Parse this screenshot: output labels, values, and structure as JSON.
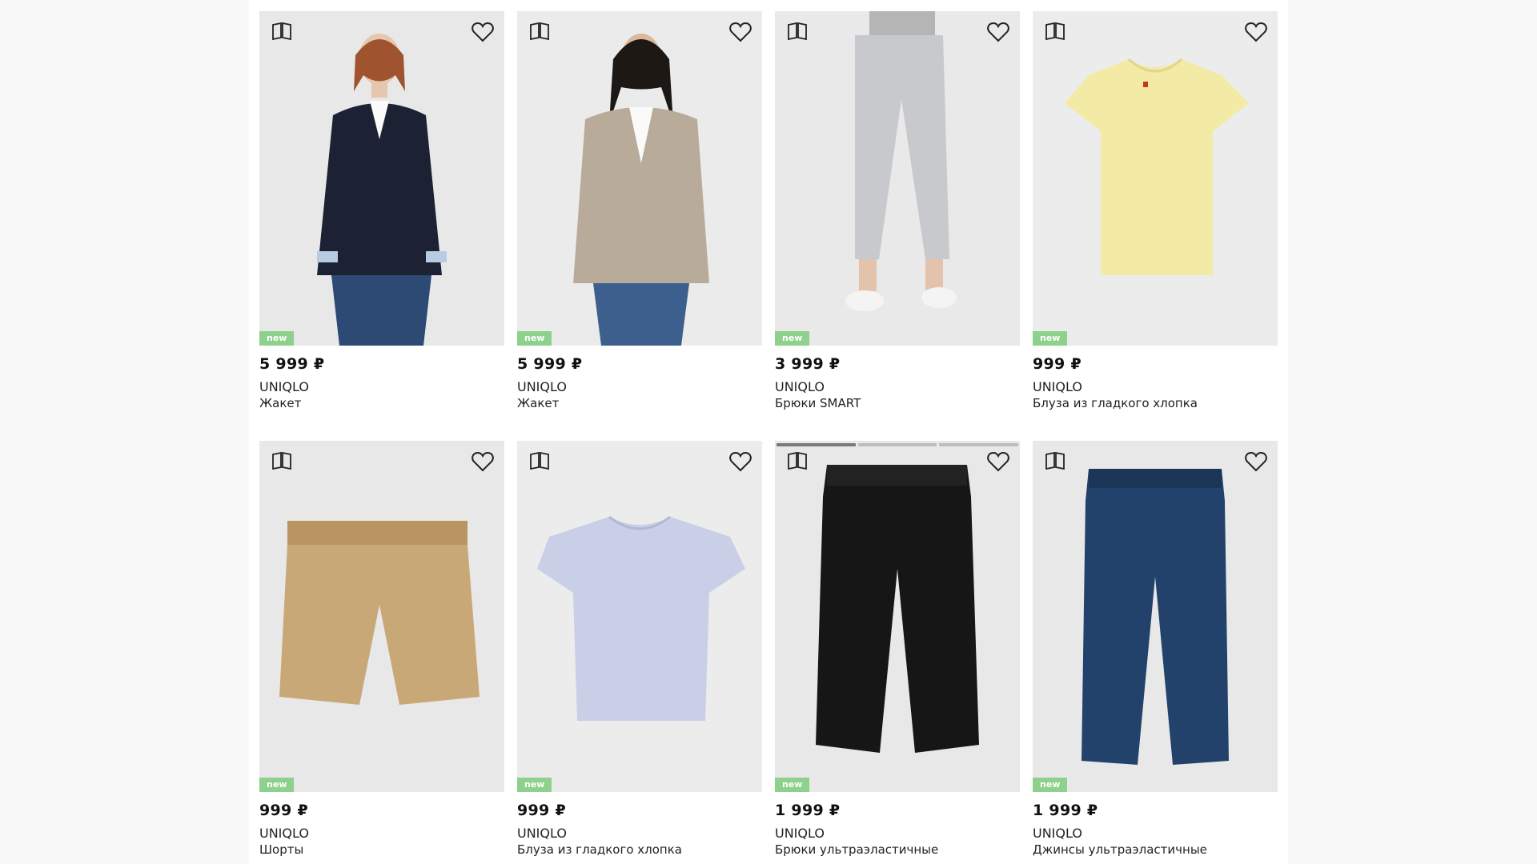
{
  "products": [
    {
      "price": "5 999 ₽",
      "brand": "UNIQLO",
      "name": "Жакет",
      "badge": "new"
    },
    {
      "price": "5 999 ₽",
      "brand": "UNIQLO",
      "name": "Жакет",
      "badge": "new"
    },
    {
      "price": "3 999 ₽",
      "brand": "UNIQLO",
      "name": "Брюки SMART",
      "badge": "new"
    },
    {
      "price": "999 ₽",
      "brand": "UNIQLO",
      "name": "Блуза из гладкого хлопка",
      "badge": "new"
    },
    {
      "price": "999 ₽",
      "brand": "UNIQLO",
      "name": "Шорты",
      "badge": "new"
    },
    {
      "price": "999 ₽",
      "brand": "UNIQLO",
      "name": "Блуза из гладкого хлопка",
      "badge": "new"
    },
    {
      "price": "1 999 ₽",
      "brand": "UNIQLO",
      "name": "Брюки ультраэластичные",
      "badge": "new"
    },
    {
      "price": "1 999 ₽",
      "brand": "UNIQLO",
      "name": "Джинсы ультраэластичные",
      "badge": "new"
    }
  ],
  "icons": {
    "compare": "compare-icon",
    "favorite": "heart-icon"
  },
  "colors": {
    "badge": "#8ed18c",
    "price": "#111111"
  }
}
